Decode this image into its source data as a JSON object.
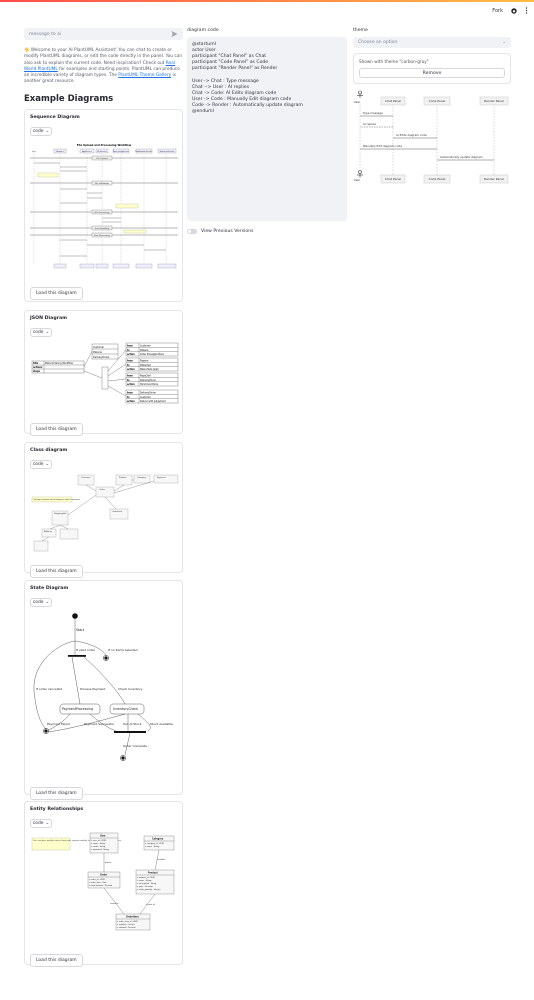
{
  "toolbar": {
    "fork_label": "Fork"
  },
  "chat": {
    "placeholder": "message to ai"
  },
  "welcome": {
    "p1": "👋 Welcome to your AI PlantUML Assistant! You can chat to create or modify PlantUML diagrams, or edit the code directly in the panel. You can also ask to explain the current code. Need inspiration? Check out ",
    "link1": "Real World PlantUML",
    "p2": " for examples and starting points. PlantUML can produce an incredible variety of diagram types. The ",
    "link2": "PlantUML Theme Gallery",
    "p3": " is another great resource."
  },
  "examples_title": "Example Diagrams",
  "select_code": "code",
  "load_button": "Load this diagram",
  "cards": {
    "sequence": "Sequence Diagram",
    "json": "JSON Diagram",
    "class": "Class diagram",
    "state": "State Diagram",
    "entity": "Entity Relationships"
  },
  "code_panel": {
    "label": "diagram code",
    "code": "@startuml\nactor User\nparticipant \"Chat Panel\" as Chat\nparticipant \"Code Panel\" as Code\nparticipant \"Render Panel\" as Render\n\nUser -> Chat : Type message\nChat --> User : AI replies\nChat -> Code: AI Edits diagram code\nUser -> Code : Manually Edit diagram code\nCode -> Render : Automatically update diagram\n@enduml",
    "toggle_label": "View Previous Versions"
  },
  "theme_panel": {
    "label": "theme",
    "placeholder": "Choose an option",
    "shown_text": "Shown with theme \"carbon-gray\"",
    "remove_label": "Remove"
  },
  "preview": {
    "participants": [
      "User",
      "Chat Panel",
      "Code Panel",
      "Render Panel"
    ],
    "messages": [
      "Type message",
      "AI replies",
      "AI Edits diagram code",
      "Manually Edit diagram code",
      "Automatically update diagram"
    ]
  },
  "seq_example": {
    "title": "File Upload and Processing Workflow",
    "participants": [
      "User",
      "Browser",
      "AppServer",
      "FileService",
      "ProcessingService",
      "NotificationService",
      "StatisticsService"
    ],
    "sections": [
      "File Upload",
      "File Validation",
      "File Processing",
      "Error Handling",
      "Post Processing"
    ]
  },
  "json_example": {
    "rows": [
      [
        "title",
        "Pizza Ordering Workflow"
      ],
      [
        "actions",
        ""
      ],
      [
        "steps",
        ""
      ]
    ],
    "actions": [
      "Customer",
      "Pizzeria",
      "DeliveryDriver"
    ],
    "steps": [
      [
        [
          "from",
          "Customer"
        ],
        [
          "to",
          "Pizzeria"
        ],
        [
          "action",
          "Order Pineapple Pizza"
        ]
      ],
      [
        [
          "from",
          "Pizzeria"
        ],
        [
          "to",
          "PizzaChef"
        ],
        [
          "action",
          "Make Pizza (sigh)"
        ]
      ],
      [
        [
          "from",
          "PizzaChef"
        ],
        [
          "to",
          "DeliveryDriver"
        ],
        [
          "action",
          "Hand Over Pizza"
        ]
      ],
      [
        [
          "from",
          "DeliveryDriver"
        ],
        [
          "to",
          "Customer"
        ],
        [
          "action",
          "Deliver with judgement"
        ]
      ]
    ]
  },
  "class_example": {
    "classes": [
      "Customer",
      "Order",
      "Product",
      "Category",
      "Payment",
      "OrderItem",
      "ShippingInfo",
      "Address"
    ],
    "note": "This page is purchase order at diagram to order for customers"
  },
  "state_example": {
    "labels": [
      "Start",
      "If valid order",
      "If no items selected",
      "Process Payment",
      "Check Inventory",
      "If order cancelled",
      "PaymentProcessing",
      "InventoryCheck",
      "Payment Failed",
      "Payment Successful",
      "Out of Stock",
      "Stock Available",
      "Order Complete"
    ]
  },
  "er_example": {
    "entities": [
      "User",
      "Category",
      "Order",
      "Product",
      "OrderItem"
    ],
    "user_fields": [
      "+ user_id : UUID",
      "+ name : String",
      "+ email : String",
      "+ password : String"
    ],
    "category_fields": [
      "+ category_id : UUID",
      "+ name : String"
    ],
    "order_fields": [
      "+ order_id : UUID",
      "+ order_date : Date",
      "+ total_amount : Decimal"
    ],
    "product_fields": [
      "+ product_id : UUID",
      "+ name : String",
      "+ description : String",
      "+ price : Decimal",
      "+ stock_quantity : Integer"
    ],
    "orderitem_fields": [
      "+ order_item_id : UUID",
      "+ quantity : Integer",
      "+ subtotal : Decimal"
    ],
    "note": "User can place multiple orders.\nEach order contains multiple items.\nProducts belong to categories.",
    "rels": [
      "places",
      "contains",
      "includes",
      "is part of"
    ]
  }
}
